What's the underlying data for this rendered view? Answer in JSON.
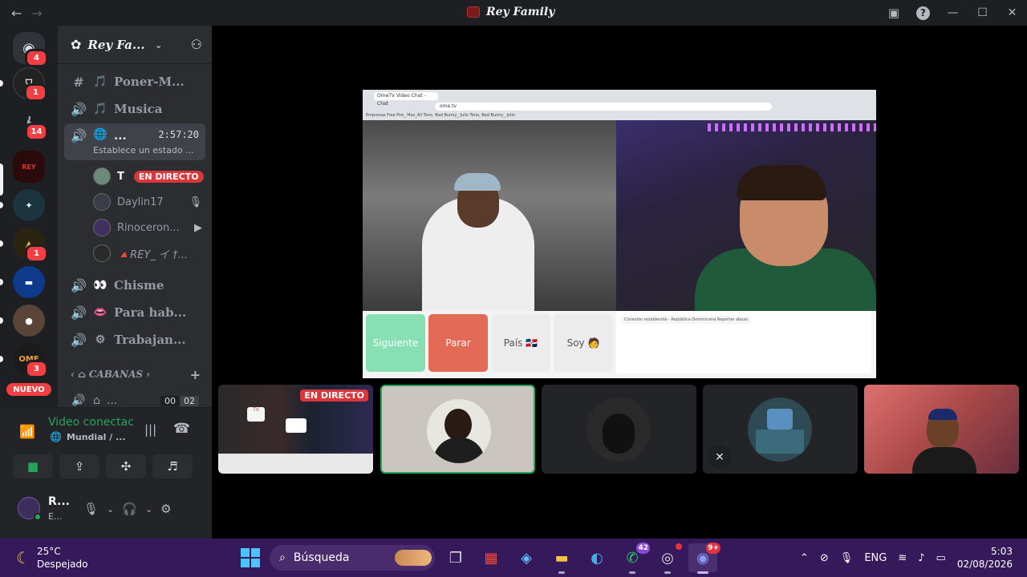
{
  "window": {
    "title": "Rey Family",
    "back_icon": "←",
    "forward_icon": "→"
  },
  "rail": {
    "home_badge": "4",
    "servers": [
      {
        "label": "",
        "badge": "1"
      },
      {
        "label": "𝄞",
        "badge": "14"
      },
      {
        "label": "",
        "badge": ""
      },
      {
        "label": "",
        "badge": ""
      },
      {
        "label": "",
        "badge": "1"
      },
      {
        "label": "",
        "badge": ""
      },
      {
        "label": "",
        "badge": ""
      },
      {
        "label": "OME",
        "badge": "3"
      }
    ],
    "nuevo_label": "NUEVO"
  },
  "guild": {
    "name": "Rey Fa...",
    "channels": [
      {
        "icon": "#",
        "emoji": "🎵",
        "name": "Poner-M..."
      },
      {
        "icon": "🔊",
        "emoji": "🎵",
        "name": "Musica"
      },
      {
        "icon": "🔊",
        "emoji": "🌐",
        "name": "...",
        "time": "2:57:20",
        "status": "Establece un estado ..."
      },
      {
        "icon": "🔊",
        "emoji": "👀",
        "name": "Chisme"
      },
      {
        "icon": "🔊",
        "emoji": "👄",
        "name": "Para hab..."
      },
      {
        "icon": "🔊",
        "emoji": "⚙",
        "name": "Trabajan..."
      }
    ],
    "members": [
      {
        "name": "T",
        "live": "EN DIRECTO",
        "icon": ""
      },
      {
        "name": "Daylin17",
        "live": "",
        "icon": "🎙"
      },
      {
        "name": "Rinoceron...",
        "live": "",
        "icon": "■"
      },
      {
        "name": "🔺REY_ イ †...",
        "live": "",
        "icon": ""
      }
    ],
    "category": "CABANAS",
    "cabana": {
      "name": "...",
      "count_a": "00",
      "count_b": "02"
    }
  },
  "voice": {
    "title": "Video conectac",
    "channel": "Mundial / ..."
  },
  "user": {
    "name": "R...",
    "status": "E..."
  },
  "screenshare": {
    "tab_text": "OmeTV Video Chat - Chat",
    "url": "ome.tv",
    "bookmarks": "Empresas   Free Fire_ Mas_All   Tono, Bad Bunny_ Julio   Tono, Bad Bunny_ Julio",
    "buttons": {
      "next": "Siguiente",
      "stop": "Parar",
      "country": "País 🇩🇴",
      "gender": "Soy 🧑"
    },
    "notice": "Conexión establecida · República Dominicana Reportar abuso"
  },
  "tiles": {
    "live_label": "EN DIRECTO"
  },
  "taskbar": {
    "weather_temp": "25°C",
    "weather_desc": "Despejado",
    "search_placeholder": "Búsqueda",
    "whatsapp_badge": "42",
    "discord_badge": "9+",
    "language": "ENG",
    "time": "5:03",
    "date": "02/08/2026"
  }
}
